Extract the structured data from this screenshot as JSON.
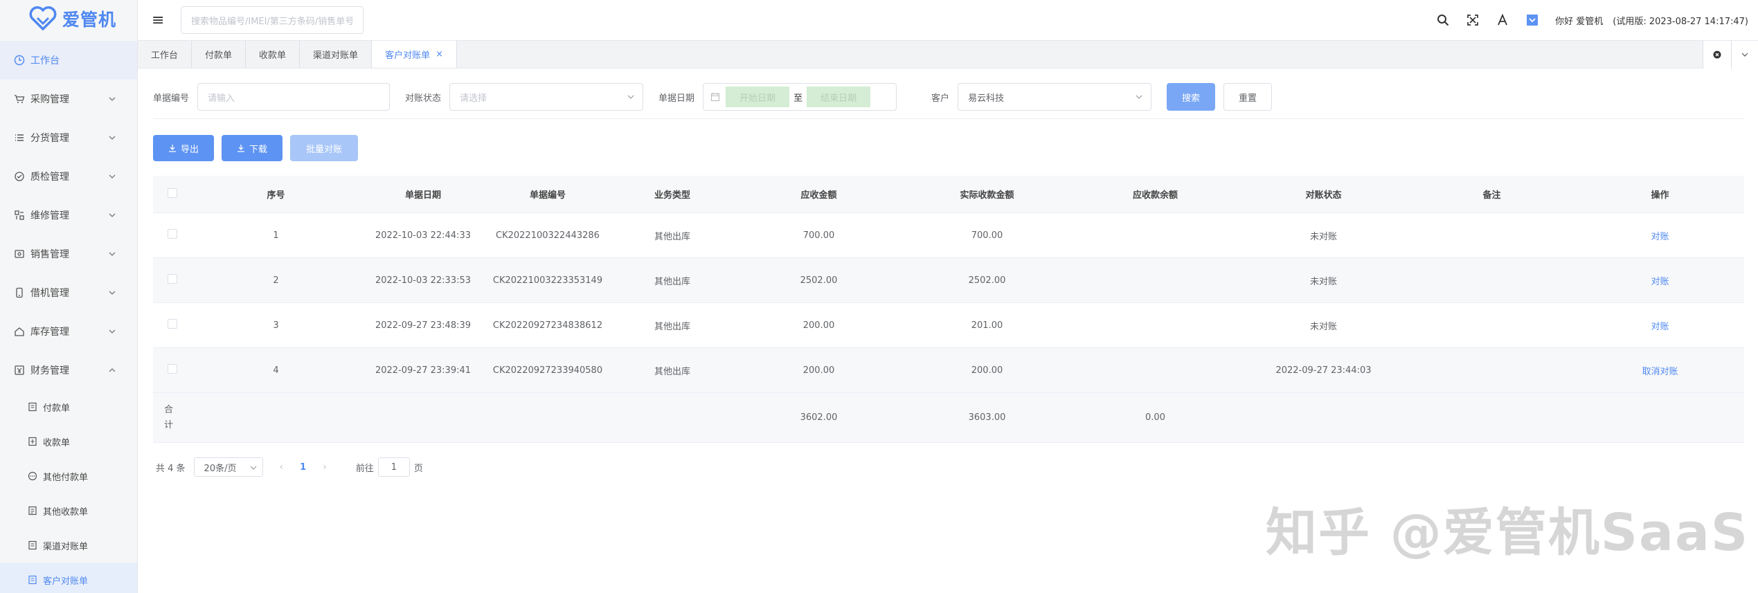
{
  "app": {
    "name": "爱管机"
  },
  "header": {
    "search_placeholder": "搜索物品编号/IMEI/第三方条码/销售单号",
    "greeting": "你好 爱管机",
    "trial": "(试用版: 2023-08-27 14:17:47)"
  },
  "sidebar": {
    "items": [
      {
        "label": "工作台",
        "icon": "clock-icon"
      },
      {
        "label": "采购管理",
        "icon": "cart-icon"
      },
      {
        "label": "分货管理",
        "icon": "list-icon"
      },
      {
        "label": "质检管理",
        "icon": "badge-icon"
      },
      {
        "label": "维修管理",
        "icon": "wrench-icon"
      },
      {
        "label": "销售管理",
        "icon": "sale-icon"
      },
      {
        "label": "借机管理",
        "icon": "phone-icon"
      },
      {
        "label": "库存管理",
        "icon": "home-icon"
      },
      {
        "label": "财务管理",
        "icon": "yen-icon"
      }
    ],
    "sub_items": [
      {
        "label": "付款单"
      },
      {
        "label": "收款单"
      },
      {
        "label": "其他付款单"
      },
      {
        "label": "其他收款单"
      },
      {
        "label": "渠道对账单"
      },
      {
        "label": "客户对账单"
      }
    ]
  },
  "tabs": [
    {
      "label": "工作台"
    },
    {
      "label": "付款单"
    },
    {
      "label": "收款单"
    },
    {
      "label": "渠道对账单"
    },
    {
      "label": "客户对账单",
      "close": "×"
    }
  ],
  "filter": {
    "doc_no_label": "单据编号",
    "doc_no_placeholder": "请输入",
    "status_label": "对账状态",
    "status_placeholder": "请选择",
    "date_label": "单据日期",
    "date_start": "开始日期",
    "date_sep": "至",
    "date_end": "结束日期",
    "customer_label": "客户",
    "customer_value": "易云科技",
    "search_btn": "搜索",
    "reset_btn": "重置"
  },
  "toolbar": {
    "export_btn": "导出",
    "download_btn": "下载",
    "batch_btn": "批量对账"
  },
  "table": {
    "columns": [
      "序号",
      "单据日期",
      "单据编号",
      "业务类型",
      "应收金额",
      "实际收款金额",
      "应收款余额",
      "对账状态",
      "备注",
      "操作"
    ],
    "rows": [
      {
        "no": "1",
        "date": "2022-10-03 22:44:33",
        "code": "CK2022100322443286",
        "type": "其他出库",
        "receivable": "700.00",
        "received": "700.00",
        "balance": "",
        "status": "未对账",
        "remark": "",
        "action": "对账"
      },
      {
        "no": "2",
        "date": "2022-10-03 22:33:53",
        "code": "CK20221003223353149",
        "type": "其他出库",
        "receivable": "2502.00",
        "received": "2502.00",
        "balance": "",
        "status": "未对账",
        "remark": "",
        "action": "对账"
      },
      {
        "no": "3",
        "date": "2022-09-27 23:48:39",
        "code": "CK20220927234838612",
        "type": "其他出库",
        "receivable": "200.00",
        "received": "201.00",
        "balance": "",
        "status": "未对账",
        "remark": "",
        "action": "对账"
      },
      {
        "no": "4",
        "date": "2022-09-27 23:39:41",
        "code": "CK20220927233940580",
        "type": "其他出库",
        "receivable": "200.00",
        "received": "200.00",
        "balance": "",
        "status": "2022-09-27 23:44:03",
        "remark": "",
        "action": "取消对账"
      }
    ],
    "footer": {
      "label_1": "合",
      "label_2": "计",
      "receivable": "3602.00",
      "received": "3603.00",
      "balance": "0.00"
    }
  },
  "pager": {
    "total": "共 4 条",
    "page_size": "20条/页",
    "prev": "‹",
    "page": "1",
    "next": "›",
    "goto": "前往",
    "goto_value": "1",
    "page_unit": "页"
  },
  "watermark": "知乎 @爱管机SaaS",
  "colors": {
    "accent": "#4f88f0",
    "primary_button": "#5d93f2",
    "sidebar_bg": "#f5f6f7"
  }
}
